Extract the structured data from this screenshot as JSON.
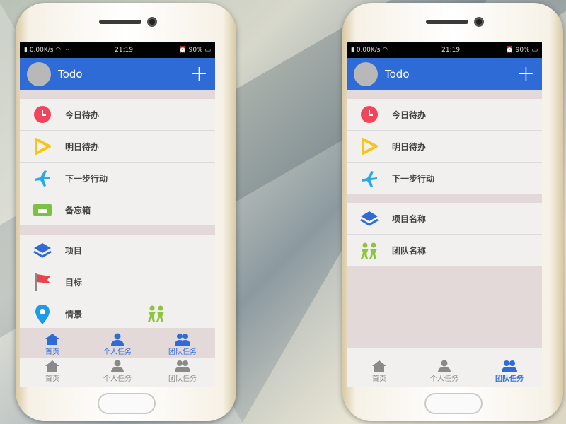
{
  "status": {
    "speed": "0.00K/s",
    "time": "21:19",
    "battery": "90%"
  },
  "app": {
    "title": "Todo"
  },
  "left_menu": {
    "group1": [
      {
        "label": "今日待办",
        "icon": "clock-icon"
      },
      {
        "label": "明日待办",
        "icon": "play-icon"
      },
      {
        "label": "下一步行动",
        "icon": "plane-icon"
      },
      {
        "label": "备忘箱",
        "icon": "inbox-icon"
      }
    ],
    "group2": [
      {
        "label": "项目",
        "icon": "layers-icon"
      },
      {
        "label": "目标",
        "icon": "flag-icon"
      },
      {
        "label": "情景",
        "icon": "location-pin-icon"
      }
    ]
  },
  "right_menu": {
    "group1": [
      {
        "label": "今日待办",
        "icon": "clock-icon"
      },
      {
        "label": "明日待办",
        "icon": "play-icon"
      },
      {
        "label": "下一步行动",
        "icon": "plane-icon"
      }
    ],
    "group2": [
      {
        "label": "项目名称",
        "icon": "layers-icon"
      },
      {
        "label": "团队名称",
        "icon": "team-icon"
      }
    ]
  },
  "tabs": {
    "home": "首页",
    "personal": "个人任务",
    "team": "团队任务"
  },
  "colors": {
    "primary": "#2f6bd6",
    "clock": "#f0455a",
    "play": "#f5c518",
    "plane": "#29a9e6",
    "inbox": "#7cc242",
    "flag": "#e8434e",
    "pin": "#1e9be8",
    "team": "#8cc63f"
  }
}
